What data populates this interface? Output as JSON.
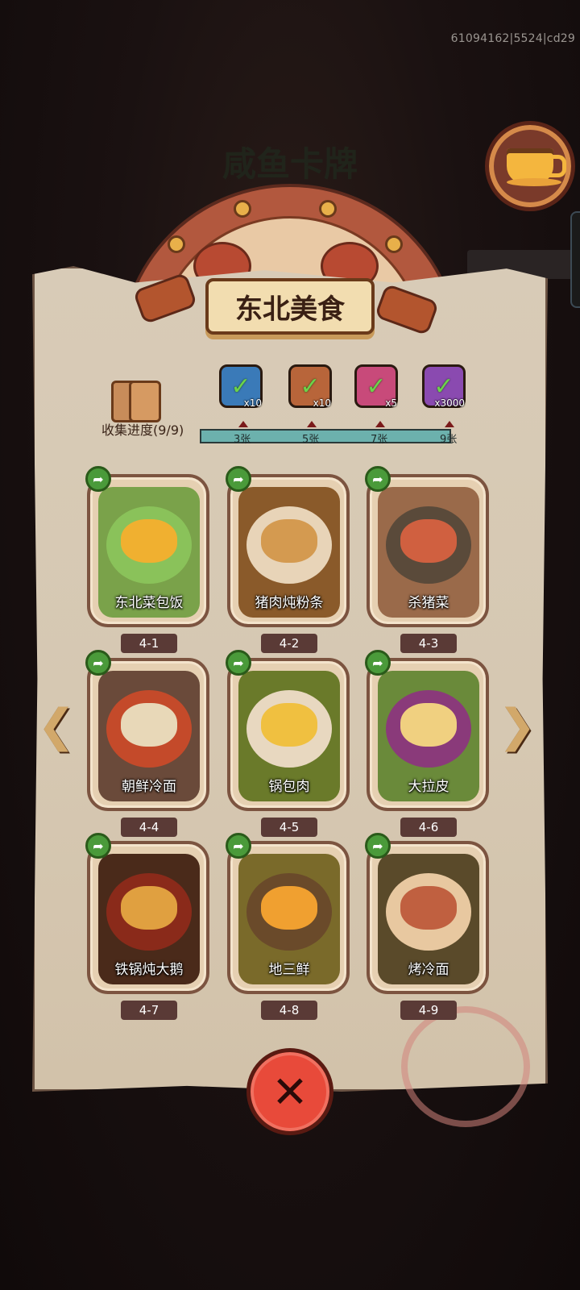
{
  "build_id": "61094162|5524|cd29",
  "background_title": "咸鱼卡牌",
  "panel": {
    "title": "东北美食",
    "collection_label": "收集进度(9/9)",
    "collection_progress": 1.0
  },
  "rewards": [
    {
      "qty": "x10",
      "color": "#3a7ab8",
      "icon": "chest-icon"
    },
    {
      "qty": "x10",
      "color": "#b8653a",
      "icon": "scroll-icon"
    },
    {
      "qty": "x5",
      "color": "#c84a7a",
      "icon": "orb-icon"
    },
    {
      "qty": "x3000",
      "color": "#8a4ab0",
      "icon": "gem-icon"
    }
  ],
  "milestones": [
    "3张",
    "5张",
    "7张",
    "9张"
  ],
  "cards": [
    {
      "name": "东北菜包饭",
      "number": "4-1",
      "bg": "#7aa24a",
      "dish": "#8ac25a",
      "top": "#f0b030"
    },
    {
      "name": "猪肉炖粉条",
      "number": "4-2",
      "bg": "#8a5a2a",
      "dish": "#e8d4b8",
      "top": "#d49a50"
    },
    {
      "name": "杀猪菜",
      "number": "4-3",
      "bg": "#9a6a4a",
      "dish": "#5a4a3a",
      "top": "#d06040"
    },
    {
      "name": "朝鲜冷面",
      "number": "4-4",
      "bg": "#6a4a3a",
      "dish": "#c44a2a",
      "top": "#e8d8b8"
    },
    {
      "name": "锅包肉",
      "number": "4-5",
      "bg": "#6a7a2a",
      "dish": "#e8d8c0",
      "top": "#f0c040"
    },
    {
      "name": "大拉皮",
      "number": "4-6",
      "bg": "#6a8a3a",
      "dish": "#8a3a7a",
      "top": "#f0d080"
    },
    {
      "name": "铁锅炖大鹅",
      "number": "4-7",
      "bg": "#4a2a1a",
      "dish": "#8a2a1a",
      "top": "#e0a040"
    },
    {
      "name": "地三鲜",
      "number": "4-8",
      "bg": "#7a6a2a",
      "dish": "#6a4a2a",
      "top": "#f0a030"
    },
    {
      "name": "烤冷面",
      "number": "4-9",
      "bg": "#5a4a2a",
      "dish": "#e8c8a0",
      "top": "#c06040"
    }
  ],
  "colors": {
    "accent_green": "#4a9a3a",
    "close_red": "#e84a3a",
    "progress_teal": "#6cb1ad"
  },
  "icons": {
    "share": "share-arrow-icon",
    "prev": "chevron-left-icon",
    "next": "chevron-right-icon",
    "close": "close-icon",
    "coffee": "coffee-cup-icon"
  }
}
